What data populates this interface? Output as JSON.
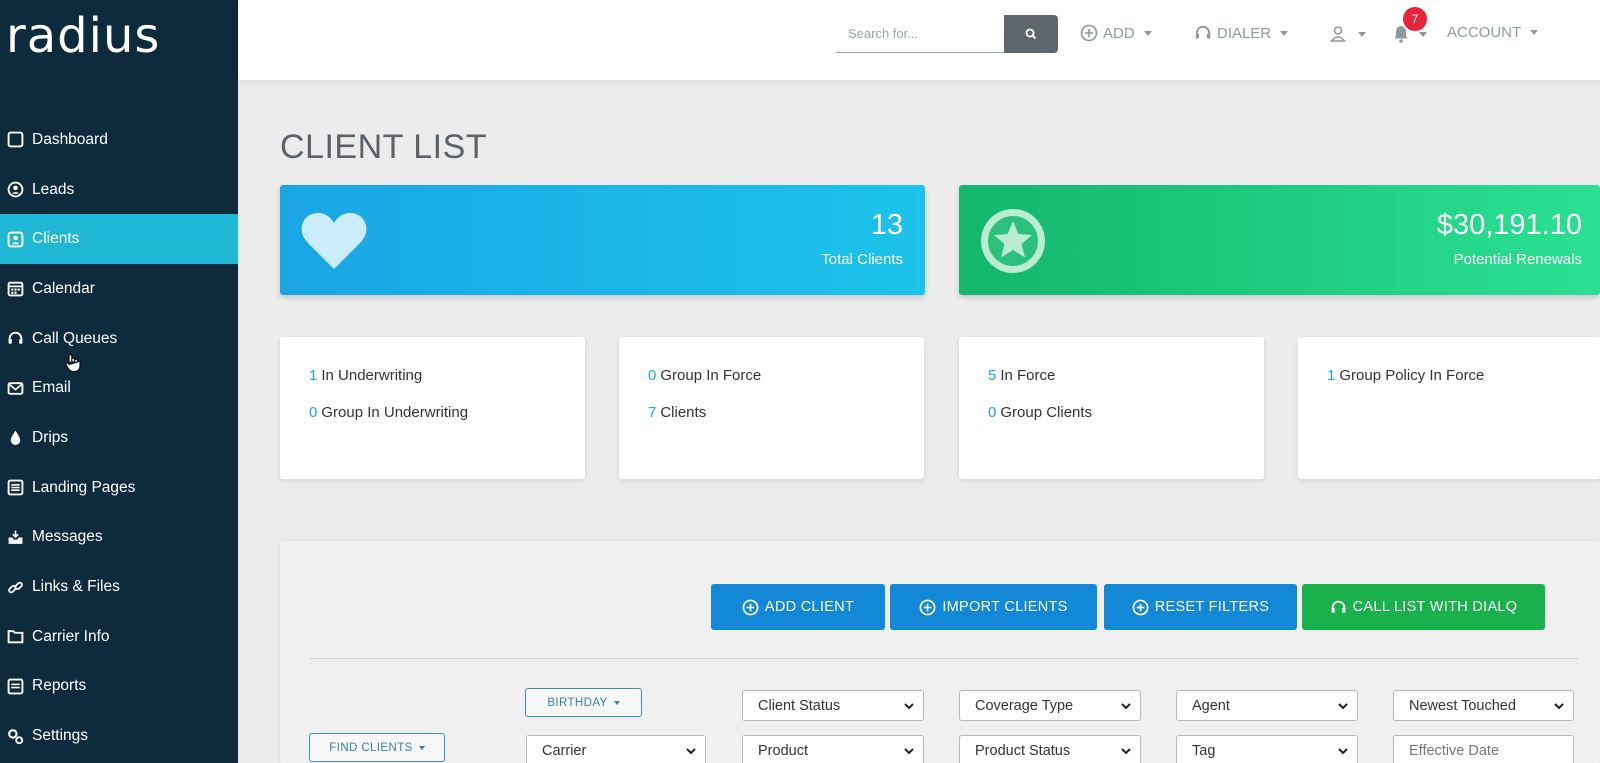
{
  "app": {
    "logo": "radius"
  },
  "colors": {
    "sidebar": "#0e2a3d",
    "active": "#20b7d4",
    "blue": "#1aa6e4",
    "green": "#13b66a",
    "badge": "#e8243b"
  },
  "sidebar": {
    "items": [
      {
        "label": "Dashboard",
        "icon": "dashboard-icon"
      },
      {
        "label": "Leads",
        "icon": "leads-icon"
      },
      {
        "label": "Clients",
        "icon": "clients-icon",
        "active": true
      },
      {
        "label": "Calendar",
        "icon": "calendar-icon"
      },
      {
        "label": "Call Queues",
        "icon": "headset-icon"
      },
      {
        "label": "Email",
        "icon": "email-icon"
      },
      {
        "label": "Drips",
        "icon": "drop-icon"
      },
      {
        "label": "Landing Pages",
        "icon": "landing-pages-icon"
      },
      {
        "label": "Messages",
        "icon": "messages-icon"
      },
      {
        "label": "Links & Files",
        "icon": "link-icon"
      },
      {
        "label": "Carrier Info",
        "icon": "folder-icon"
      },
      {
        "label": "Reports",
        "icon": "reports-icon"
      },
      {
        "label": "Settings",
        "icon": "settings-icon"
      }
    ]
  },
  "topbar": {
    "search_placeholder": "Search for...",
    "add_label": "ADD",
    "dialer_label": "DIALER",
    "notification_count": "7",
    "account_label": "ACCOUNT"
  },
  "main": {
    "title": "CLIENT LIST",
    "stats": [
      {
        "value": "13",
        "label": "Total Clients",
        "icon": "heart-icon"
      },
      {
        "value": "$30,191.10",
        "label": "Potential Renewals",
        "icon": "star-icon"
      }
    ],
    "info_cards": [
      [
        {
          "num": "1",
          "text": "In Underwriting"
        },
        {
          "num": "0",
          "text": "Group In Underwriting"
        }
      ],
      [
        {
          "num": "0",
          "text": "Group In Force"
        },
        {
          "num": "7",
          "text": "Clients"
        }
      ],
      [
        {
          "num": "5",
          "text": "In Force"
        },
        {
          "num": "0",
          "text": "Group Clients"
        }
      ],
      [
        {
          "num": "1",
          "text": "Group Policy In Force"
        }
      ]
    ],
    "actions": {
      "add_client": "ADD CLIENT",
      "import_clients": "IMPORT CLIENTS",
      "reset_filters": "RESET FILTERS",
      "call_list": "CALL LIST WITH DIALQ"
    },
    "filters": {
      "birthday": "BIRTHDAY",
      "find_clients": "FIND CLIENTS",
      "client_status": "Client Status",
      "coverage_type": "Coverage Type",
      "agent": "Agent",
      "newest_touched": "Newest Touched",
      "carrier": "Carrier",
      "product": "Product",
      "product_status": "Product Status",
      "tag": "Tag",
      "effective_date": "Effective Date"
    }
  }
}
